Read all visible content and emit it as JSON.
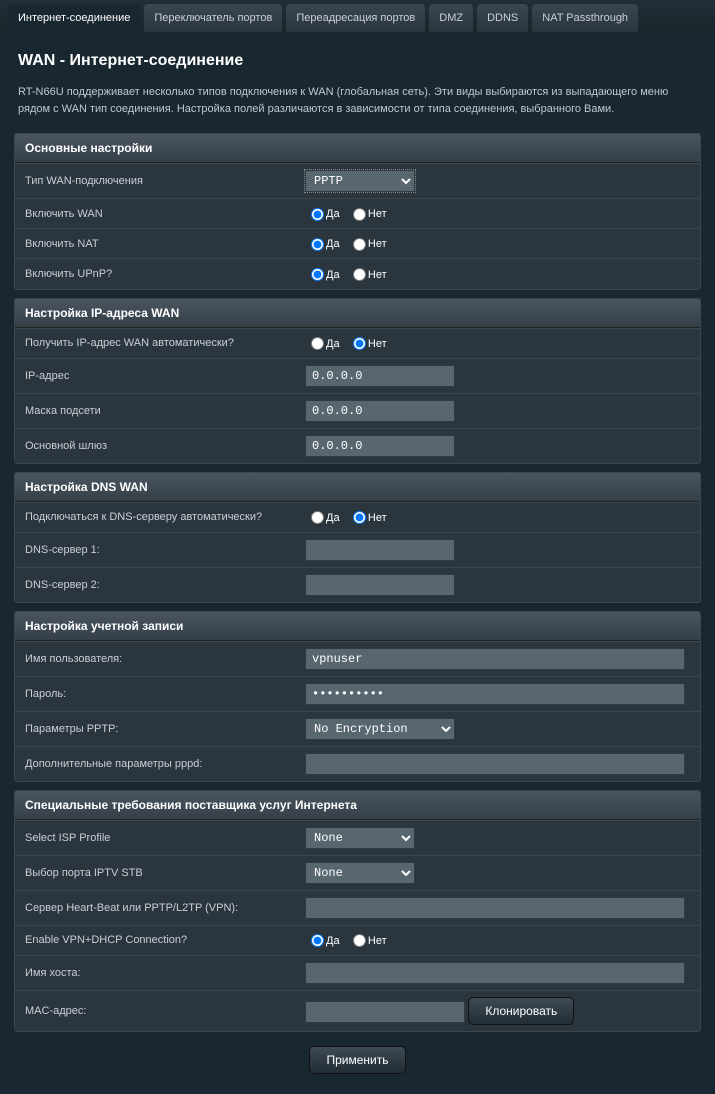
{
  "tabs": [
    "Интернет-соединение",
    "Переключатель портов",
    "Переадресация портов",
    "DMZ",
    "DDNS",
    "NAT Passthrough"
  ],
  "page_title": "WAN - Интернет-соединение",
  "description": "RT-N66U поддерживает несколько типов подключения к WAN (глобальная сеть). Эти виды выбираются из выпадающего меню рядом с WAN тип соединения. Настройка полей различаются в зависимости от типа соединения, выбранного Вами.",
  "radio": {
    "yes": "Да",
    "no": "Нет"
  },
  "s1": {
    "head": "Основные настройки",
    "wan_type_label": "Тип WAN-подключения",
    "wan_type_value": "PPTP",
    "enable_wan": "Включить WAN",
    "enable_nat": "Включить NAT",
    "enable_upnp": "Включить UPnP?"
  },
  "s2": {
    "head": "Настройка IP-адреса WAN",
    "auto_ip": "Получить IP-адрес WAN автоматически?",
    "ip_label": "IP-адрес",
    "ip_value": "0.0.0.0",
    "mask_label": "Маска подсети",
    "mask_value": "0.0.0.0",
    "gw_label": "Основной шлюз",
    "gw_value": "0.0.0.0"
  },
  "s3": {
    "head": "Настройка DNS WAN",
    "auto_dns": "Подключаться к DNS-серверу автоматически?",
    "dns1": "DNS-сервер 1:",
    "dns2": "DNS-сервер 2:"
  },
  "s4": {
    "head": "Настройка учетной записи",
    "user_label": "Имя пользователя:",
    "user_value": "vpnuser",
    "pass_label": "Пароль:",
    "pass_value": "••••••••••",
    "pptp_label": "Параметры PPTP:",
    "pptp_value": "No Encryption",
    "pppd_label": "Дополнительные параметры pppd:"
  },
  "s5": {
    "head": "Специальные требования поставщика услуг Интернета",
    "isp_label": "Select ISP Profile",
    "isp_value": "None",
    "iptv_label": "Выбор порта IPTV STB",
    "iptv_value": "None",
    "hb_label": "Сервер Heart-Beat или PPTP/L2TP (VPN):",
    "vpn_dhcp": "Enable VPN+DHCP Connection?",
    "host_label": "Имя хоста:",
    "mac_label": "MAC-адрес:",
    "clone": "Клонировать"
  },
  "apply": "Применить"
}
